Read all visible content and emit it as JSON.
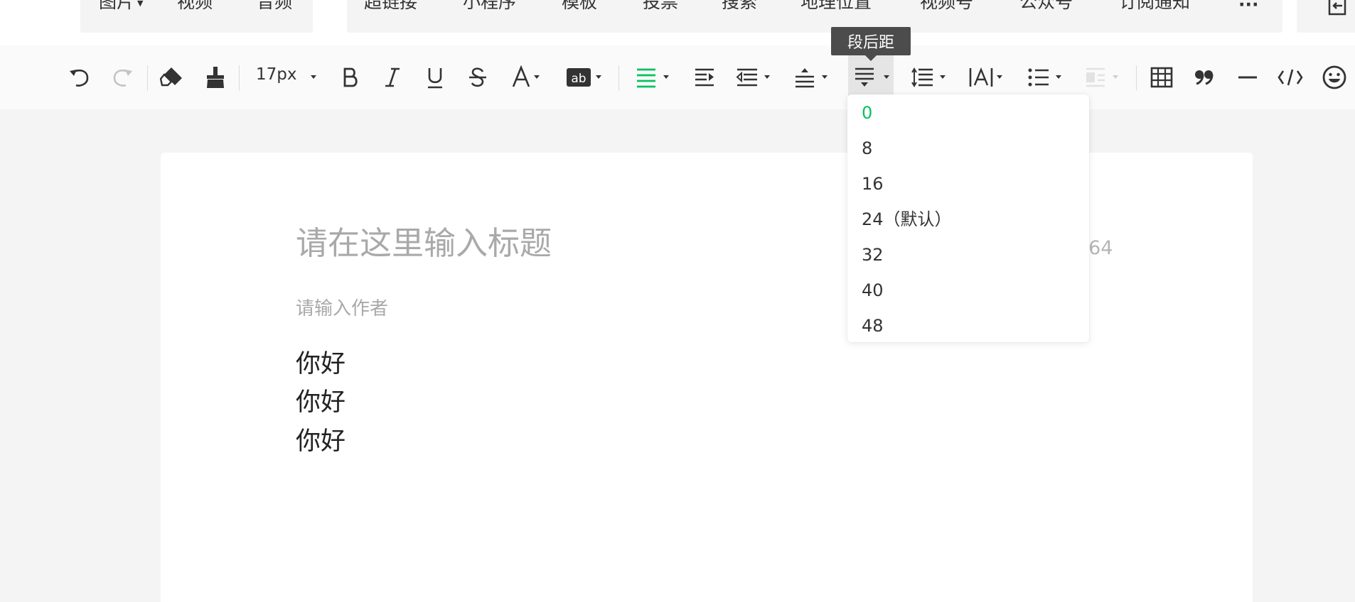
{
  "insert_bar": {
    "group1": [
      {
        "label": "图片",
        "has_caret": true
      },
      {
        "label": "视频"
      },
      {
        "label": "音频"
      }
    ],
    "group2": [
      {
        "label": "超链接"
      },
      {
        "label": "小程序"
      },
      {
        "label": "模板"
      },
      {
        "label": "投票"
      },
      {
        "label": "搜索"
      },
      {
        "label": "地理位置"
      },
      {
        "label": "视频号"
      },
      {
        "label": "公众号"
      },
      {
        "label": "订阅通知"
      },
      {
        "label": "···"
      }
    ]
  },
  "toolbar": {
    "font_size": "17px",
    "active_tool": "paragraph-spacing-after",
    "tooltip": "段后距",
    "accent_color": "#07c160",
    "icons": [
      "undo-icon",
      "redo-icon",
      "clear-format-icon",
      "format-painter-icon",
      "bold-icon",
      "italic-icon",
      "underline-icon",
      "strikethrough-icon",
      "font-color-icon",
      "background-color-icon",
      "align-icon",
      "indent-icon",
      "first-line-indent-icon",
      "spacing-before-icon",
      "spacing-after-icon",
      "line-height-icon",
      "letter-spacing-icon",
      "list-icon",
      "float-icon",
      "table-icon",
      "quote-icon",
      "divider-icon",
      "code-icon",
      "emoji-icon"
    ]
  },
  "editor": {
    "title_placeholder": "请在这里输入标题",
    "title_counter": "/64",
    "author_placeholder": "请输入作者",
    "body_lines": [
      "你好",
      "你好",
      "你好"
    ]
  },
  "spacing_dropdown": {
    "selected": "0",
    "options": [
      "0",
      "8",
      "16",
      "24（默认）",
      "32",
      "40",
      "48"
    ]
  }
}
